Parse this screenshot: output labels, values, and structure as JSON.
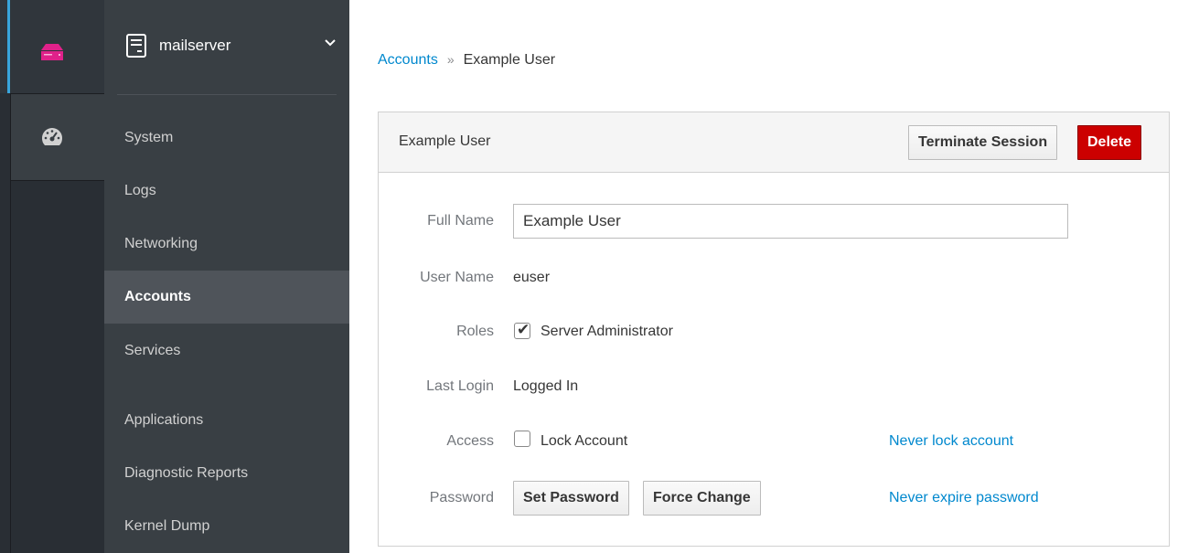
{
  "host": {
    "name": "mailserver"
  },
  "nav": {
    "items": [
      {
        "label": "System"
      },
      {
        "label": "Logs"
      },
      {
        "label": "Networking"
      },
      {
        "label": "Accounts"
      },
      {
        "label": "Services"
      },
      {
        "label": "Applications"
      },
      {
        "label": "Diagnostic Reports"
      },
      {
        "label": "Kernel Dump"
      }
    ],
    "active": "Accounts"
  },
  "breadcrumb": {
    "parent": "Accounts",
    "separator": "»",
    "current": "Example User"
  },
  "panel": {
    "title": "Example User",
    "terminate_label": "Terminate Session",
    "delete_label": "Delete"
  },
  "form": {
    "full_name": {
      "label": "Full Name",
      "value": "Example User"
    },
    "user_name": {
      "label": "User Name",
      "value": "euser"
    },
    "roles": {
      "label": "Roles",
      "option": "Server Administrator",
      "checked": true
    },
    "last_login": {
      "label": "Last Login",
      "value": "Logged In"
    },
    "access": {
      "label": "Access",
      "option": "Lock Account",
      "checked": false,
      "link": "Never lock account"
    },
    "password": {
      "label": "Password",
      "set_label": "Set Password",
      "force_label": "Force Change",
      "link": "Never expire password"
    }
  },
  "colors": {
    "accent": "#0088ce",
    "danger": "#cc0000",
    "server_icon": "#e0218a",
    "rail_accent": "#39a5dc"
  }
}
